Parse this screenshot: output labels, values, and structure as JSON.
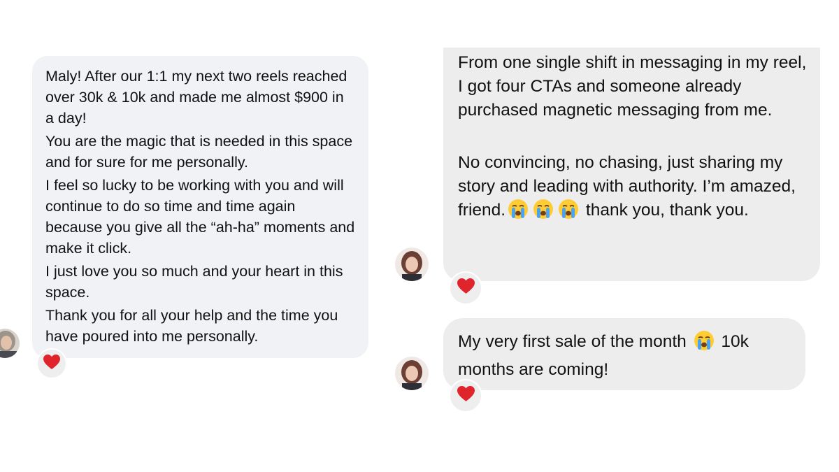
{
  "left_conversation": {
    "message": {
      "paragraphs": [
        "Maly! After our 1:1 my next two reels reached over 30k & 10k and made me almost $900 in a day!",
        "You are the magic that is needed in this space and for sure for me personally.",
        "I feel so lucky to be working with you and will continue to do so time and time again because you give all the “ah-ha” moments and make it click.",
        "I just love you so much and your heart in this space.",
        "Thank you for all your help and the time you have poured into me personally."
      ],
      "reaction": "heart-icon"
    }
  },
  "right_conversation": {
    "message_1": {
      "paragraph_1": "From one single shift in messaging in my reel, I got four CTAs and someone already purchased magnetic messaging from me.",
      "paragraph_2_before_emoji": "No convincing, no chasing, just sharing my story and leading with authority. I’m amazed, friend.",
      "paragraph_2_after_emoji": "thank you, thank you.",
      "emojis": [
        "crying-face-icon",
        "crying-face-icon",
        "crying-face-icon"
      ],
      "reaction": "heart-icon"
    },
    "message_2": {
      "text_before_emoji": "My very first sale of the month",
      "text_after_emoji": "10k months are coming!",
      "emoji": "crying-face-icon",
      "reaction": "heart-icon"
    }
  },
  "colors": {
    "left_bubble": "#f1f2f5",
    "right_bubble": "#ededed",
    "heart": "#e0242b"
  }
}
